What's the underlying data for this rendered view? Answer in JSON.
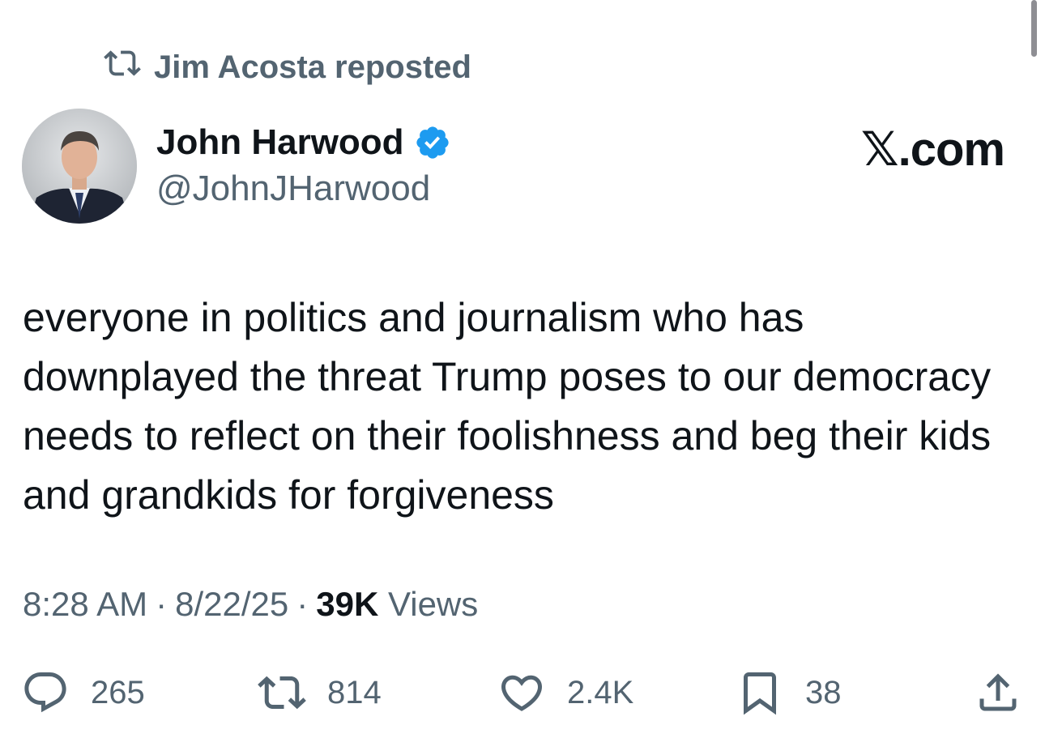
{
  "repost": {
    "icon": "repost-icon",
    "label": "Jim Acosta reposted"
  },
  "author": {
    "name": "John Harwood",
    "handle": "@JohnJHarwood",
    "verified": true,
    "verified_color": "#1d9bf0"
  },
  "brand": {
    "logo_letter": "𝕏",
    "domain_suffix": ".com"
  },
  "tweet": {
    "text": "everyone in politics and journalism who has downplayed the threat Trump poses to our democracy needs to reflect on their foolishness and beg their kids and grandkids for forgiveness",
    "time": "8:28 AM",
    "date": "8/22/25",
    "separator": "·",
    "views_count": "39K",
    "views_label": "Views"
  },
  "actions": {
    "replies": "265",
    "reposts": "814",
    "likes": "2.4K",
    "bookmarks": "38"
  },
  "colors": {
    "text_primary": "#0f1419",
    "text_secondary": "#536471",
    "accent": "#1d9bf0"
  }
}
